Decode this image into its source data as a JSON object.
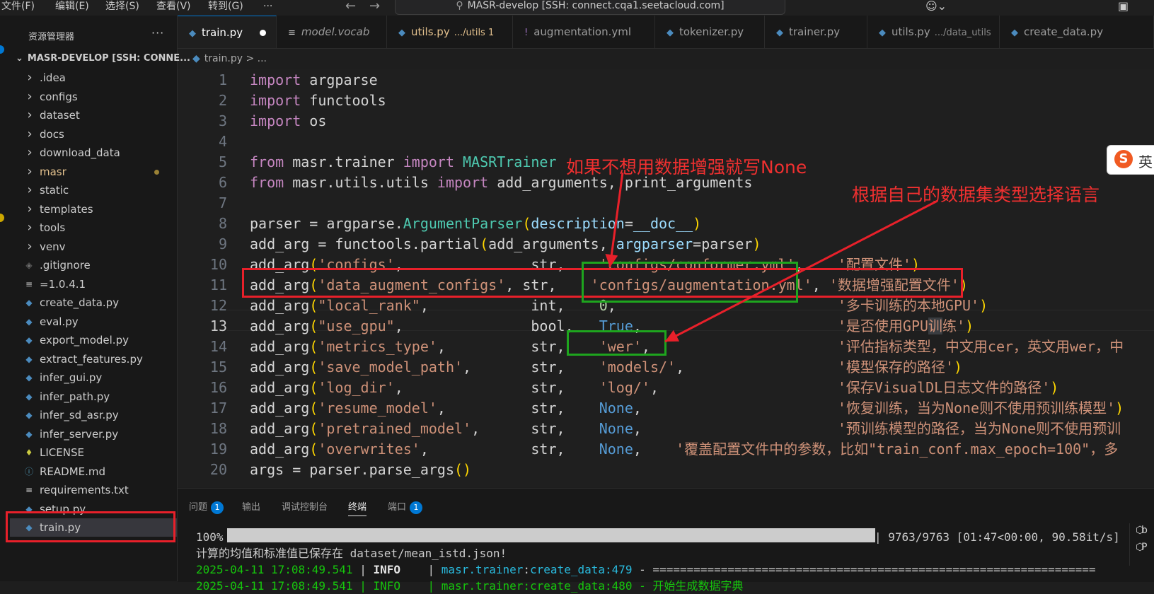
{
  "titlebar": {
    "menus": [
      "文件(F)",
      "编辑(E)",
      "选择(S)",
      "查看(V)",
      "转到(G)",
      "···"
    ],
    "back_icon": "arrow-left-icon",
    "forward_icon": "arrow-right-icon",
    "command_center": "MASR-develop [SSH: connect.cqa1.seetacloud.com]",
    "right_icons": [
      "copilot-icon",
      "layout-icon"
    ]
  },
  "sidebar": {
    "title": "资源管理器",
    "more": "···",
    "root": "MASR-DEVELOP [SSH: CONNE...",
    "items": [
      {
        "label": ".idea",
        "type": "folder"
      },
      {
        "label": "configs",
        "type": "folder"
      },
      {
        "label": "dataset",
        "type": "folder"
      },
      {
        "label": "docs",
        "type": "folder"
      },
      {
        "label": "download_data",
        "type": "folder"
      },
      {
        "label": "masr",
        "type": "folder",
        "modified": true
      },
      {
        "label": "static",
        "type": "folder"
      },
      {
        "label": "templates",
        "type": "folder"
      },
      {
        "label": "tools",
        "type": "folder"
      },
      {
        "label": "venv",
        "type": "folder"
      },
      {
        "label": ".gitignore",
        "type": "file",
        "icon": "git-icon"
      },
      {
        "label": "=1.0.4.1",
        "type": "file",
        "icon": "lines-icon"
      },
      {
        "label": "create_data.py",
        "type": "file",
        "icon": "python-icon"
      },
      {
        "label": "eval.py",
        "type": "file",
        "icon": "python-icon"
      },
      {
        "label": "export_model.py",
        "type": "file",
        "icon": "python-icon"
      },
      {
        "label": "extract_features.py",
        "type": "file",
        "icon": "python-icon"
      },
      {
        "label": "infer_gui.py",
        "type": "file",
        "icon": "python-icon"
      },
      {
        "label": "infer_path.py",
        "type": "file",
        "icon": "python-icon"
      },
      {
        "label": "infer_sd_asr.py",
        "type": "file",
        "icon": "python-icon"
      },
      {
        "label": "infer_server.py",
        "type": "file",
        "icon": "python-icon"
      },
      {
        "label": "LICENSE",
        "type": "file",
        "icon": "license-icon"
      },
      {
        "label": "README.md",
        "type": "file",
        "icon": "info-icon"
      },
      {
        "label": "requirements.txt",
        "type": "file",
        "icon": "lines-icon"
      },
      {
        "label": "setup.py",
        "type": "file",
        "icon": "python-icon"
      },
      {
        "label": "train.py",
        "type": "file",
        "icon": "python-icon",
        "selected": true
      }
    ]
  },
  "tabs": [
    {
      "name": "train.py",
      "path": "",
      "icon": "python-icon",
      "active": true,
      "dirty": true
    },
    {
      "name": "model.vocab",
      "path": "",
      "icon": "lines-icon"
    },
    {
      "name": "utils.py",
      "path": ".../utils 1",
      "icon": "python-icon",
      "modified": true
    },
    {
      "name": "augmentation.yml",
      "path": "",
      "icon": "exclaim-icon"
    },
    {
      "name": "tokenizer.py",
      "path": "",
      "icon": "python-icon"
    },
    {
      "name": "trainer.py",
      "path": "",
      "icon": "python-icon"
    },
    {
      "name": "utils.py",
      "path": ".../data_utils",
      "icon": "python-icon"
    },
    {
      "name": "create_data.py",
      "path": "",
      "icon": "python-icon"
    }
  ],
  "breadcrumb": "train.py > ...",
  "editor": {
    "line_numbers": [
      "1",
      "2",
      "3",
      "4",
      "5",
      "6",
      "7",
      "8",
      "9",
      "10",
      "11",
      "12",
      "13",
      "14",
      "15",
      "16",
      "17",
      "18",
      "19",
      "20"
    ],
    "active_line": "13"
  },
  "annotations": {
    "augment_note": "如果不想用数据增强就写None",
    "language_note": "根据自己的数据集类型选择语言"
  },
  "ime": {
    "logo": "S",
    "mode": "英"
  },
  "panel": {
    "tabs": [
      {
        "label": "问题",
        "badge": "1"
      },
      {
        "label": "输出",
        "badge": ""
      },
      {
        "label": "调试控制台",
        "badge": ""
      },
      {
        "label": "终端",
        "badge": "",
        "active": true
      },
      {
        "label": "端口",
        "badge": "1"
      }
    ],
    "progress": {
      "percent": "100%",
      "fraction": 1.0,
      "stats": "| 9763/9763 [01:47<00:00, 90.58it/s]"
    },
    "line2": "计算的均值和标准值已保存在 dataset/mean_istd.json!",
    "line3": {
      "timestamp": "2025-04-11 17:08:49.541",
      "sep1": " | ",
      "level": "INFO",
      "sep2": "    | ",
      "module": "masr.trainer",
      "colon": ":",
      "func": "create_data",
      "lineno": ":479",
      "rest": " - ================================================================="
    },
    "line4_partial": "2025-04-11 17:08:49.541 | INFO    | masr.trainer:create_data:480 - 开始生成数据字典",
    "side_tabs": [
      "b",
      "P"
    ]
  }
}
